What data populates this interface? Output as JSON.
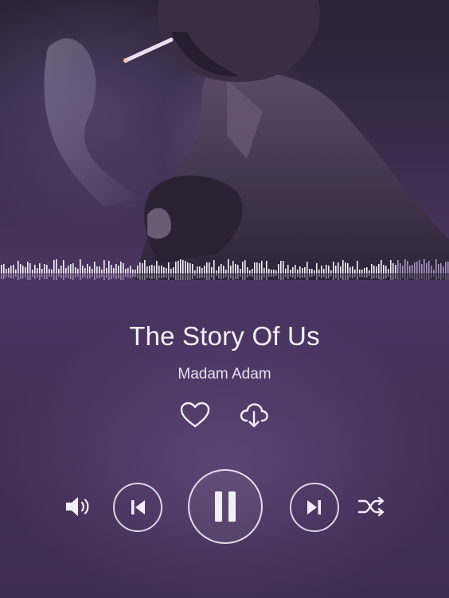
{
  "track": {
    "title": "The Story Of Us",
    "artist": "Madam Adam"
  },
  "actions": {
    "like_icon": "heart-icon",
    "download_icon": "cloud-download-icon"
  },
  "controls": {
    "volume_icon": "volume-icon",
    "previous_icon": "skip-previous-icon",
    "play_pause_icon": "pause-icon",
    "next_icon": "skip-next-icon",
    "shuffle_icon": "shuffle-icon",
    "state": "playing"
  },
  "playback": {
    "progress_fraction": 0.88
  },
  "colors": {
    "background": "#3d2c52",
    "accent": "#f2eef7",
    "waveform_played": "#f4f0f8",
    "waveform_remaining": "#a895c4"
  }
}
